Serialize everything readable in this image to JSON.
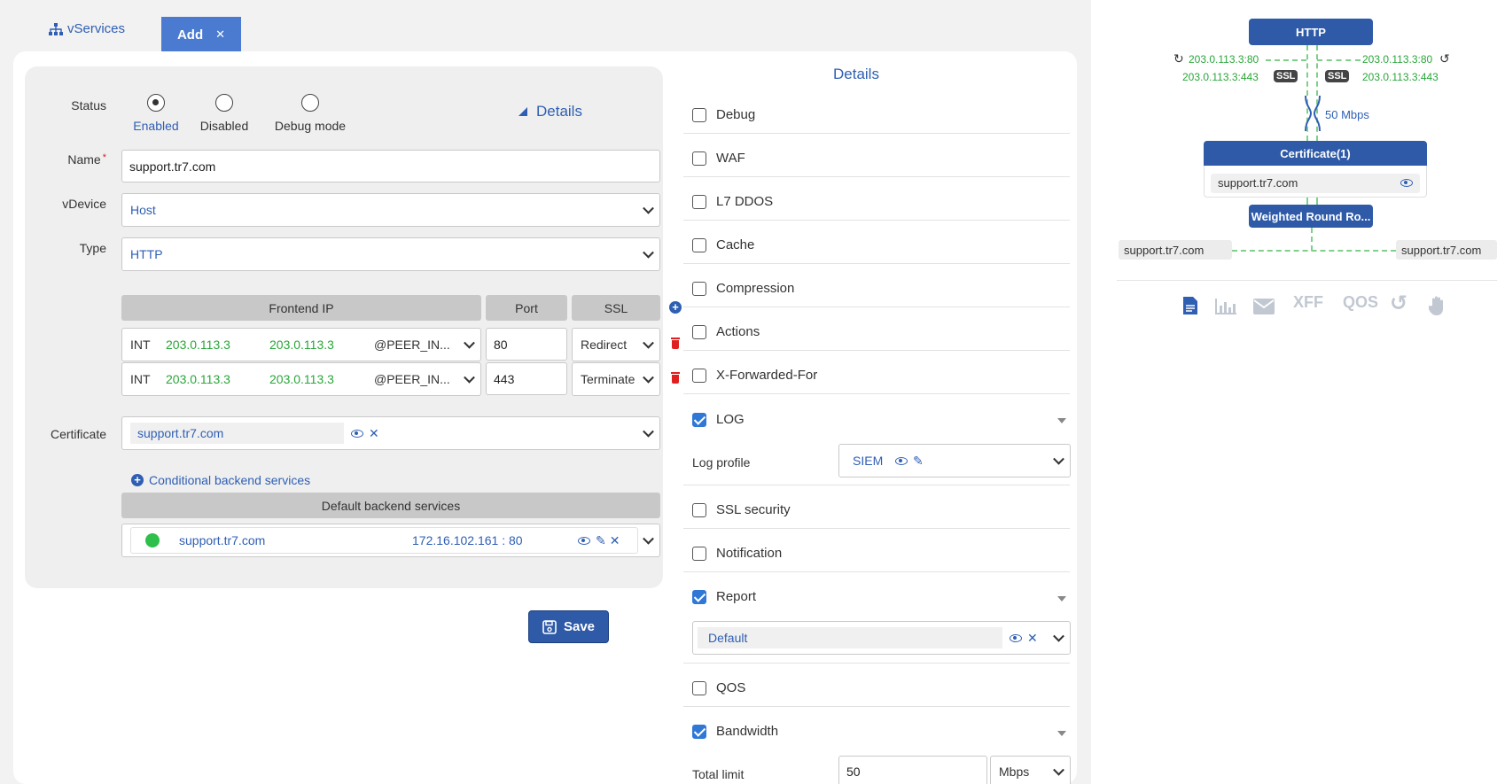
{
  "tabs": {
    "vservices": "vServices",
    "add": "Add",
    "close": "✕"
  },
  "form": {
    "status_label": "Status",
    "status_options": [
      "Enabled",
      "Disabled",
      "Debug mode"
    ],
    "status_selected": "Enabled",
    "details_toggle": "Details",
    "name_label": "Name",
    "required_mark": "*",
    "name_value": "support.tr7.com",
    "vdevice_label": "vDevice",
    "vdevice_value": "Host",
    "type_label": "Type",
    "type_value": "HTTP",
    "frontend": {
      "headers": [
        "Frontend IP",
        "Port",
        "SSL"
      ],
      "rows": [
        {
          "iface": "INT",
          "ip1": "203.0.113.3",
          "ip2": "203.0.113.3",
          "peer": "@PEER_IN...",
          "port": "80",
          "ssl": "Redirect"
        },
        {
          "iface": "INT",
          "ip1": "203.0.113.3",
          "ip2": "203.0.113.3",
          "peer": "@PEER_IN...",
          "port": "443",
          "ssl": "Terminate"
        }
      ]
    },
    "certificate_label": "Certificate",
    "certificate_value": "support.tr7.com",
    "conditional_link": "Conditional backend services",
    "default_backend_header": "Default backend services",
    "backend": {
      "name": "support.tr7.com",
      "address": "172.16.102.161 : 80",
      "status_color": "#2ec04a"
    },
    "save_label": "Save"
  },
  "details": {
    "title": "Details",
    "items": [
      {
        "label": "Debug",
        "checked": false
      },
      {
        "label": "WAF",
        "checked": false
      },
      {
        "label": "L7 DDOS",
        "checked": false
      },
      {
        "label": "Cache",
        "checked": false
      },
      {
        "label": "Compression",
        "checked": false
      },
      {
        "label": "Actions",
        "checked": false
      },
      {
        "label": "X-Forwarded-For",
        "checked": false
      },
      {
        "label": "LOG",
        "checked": true
      },
      {
        "label": "SSL security",
        "checked": false
      },
      {
        "label": "Notification",
        "checked": false
      },
      {
        "label": "Report",
        "checked": true
      },
      {
        "label": "QOS",
        "checked": false
      },
      {
        "label": "Bandwidth",
        "checked": true
      }
    ],
    "log_profile_label": "Log profile",
    "log_profile_value": "SIEM",
    "report_value": "Default",
    "total_limit_label": "Total limit",
    "total_limit_value": "50",
    "total_limit_unit": "Mbps"
  },
  "diagram": {
    "top_node": "HTTP",
    "left_ip_80": "203.0.113.3:80",
    "right_ip_80": "203.0.113.3:80",
    "left_ip_443": "203.0.113.3:443",
    "right_ip_443": "203.0.113.3:443",
    "ssl_badge": "SSL",
    "bandwidth": "50 Mbps",
    "cert_node": "Certificate(1)",
    "cert_item": "support.tr7.com",
    "lb_node": "Weighted Round Ro...",
    "backend_left": "support.tr7.com",
    "backend_right": "support.tr7.com",
    "toolbar": [
      "document-icon",
      "chart-icon",
      "mail-icon",
      "XFF",
      "QOS",
      "history-icon",
      "hand-icon"
    ]
  }
}
